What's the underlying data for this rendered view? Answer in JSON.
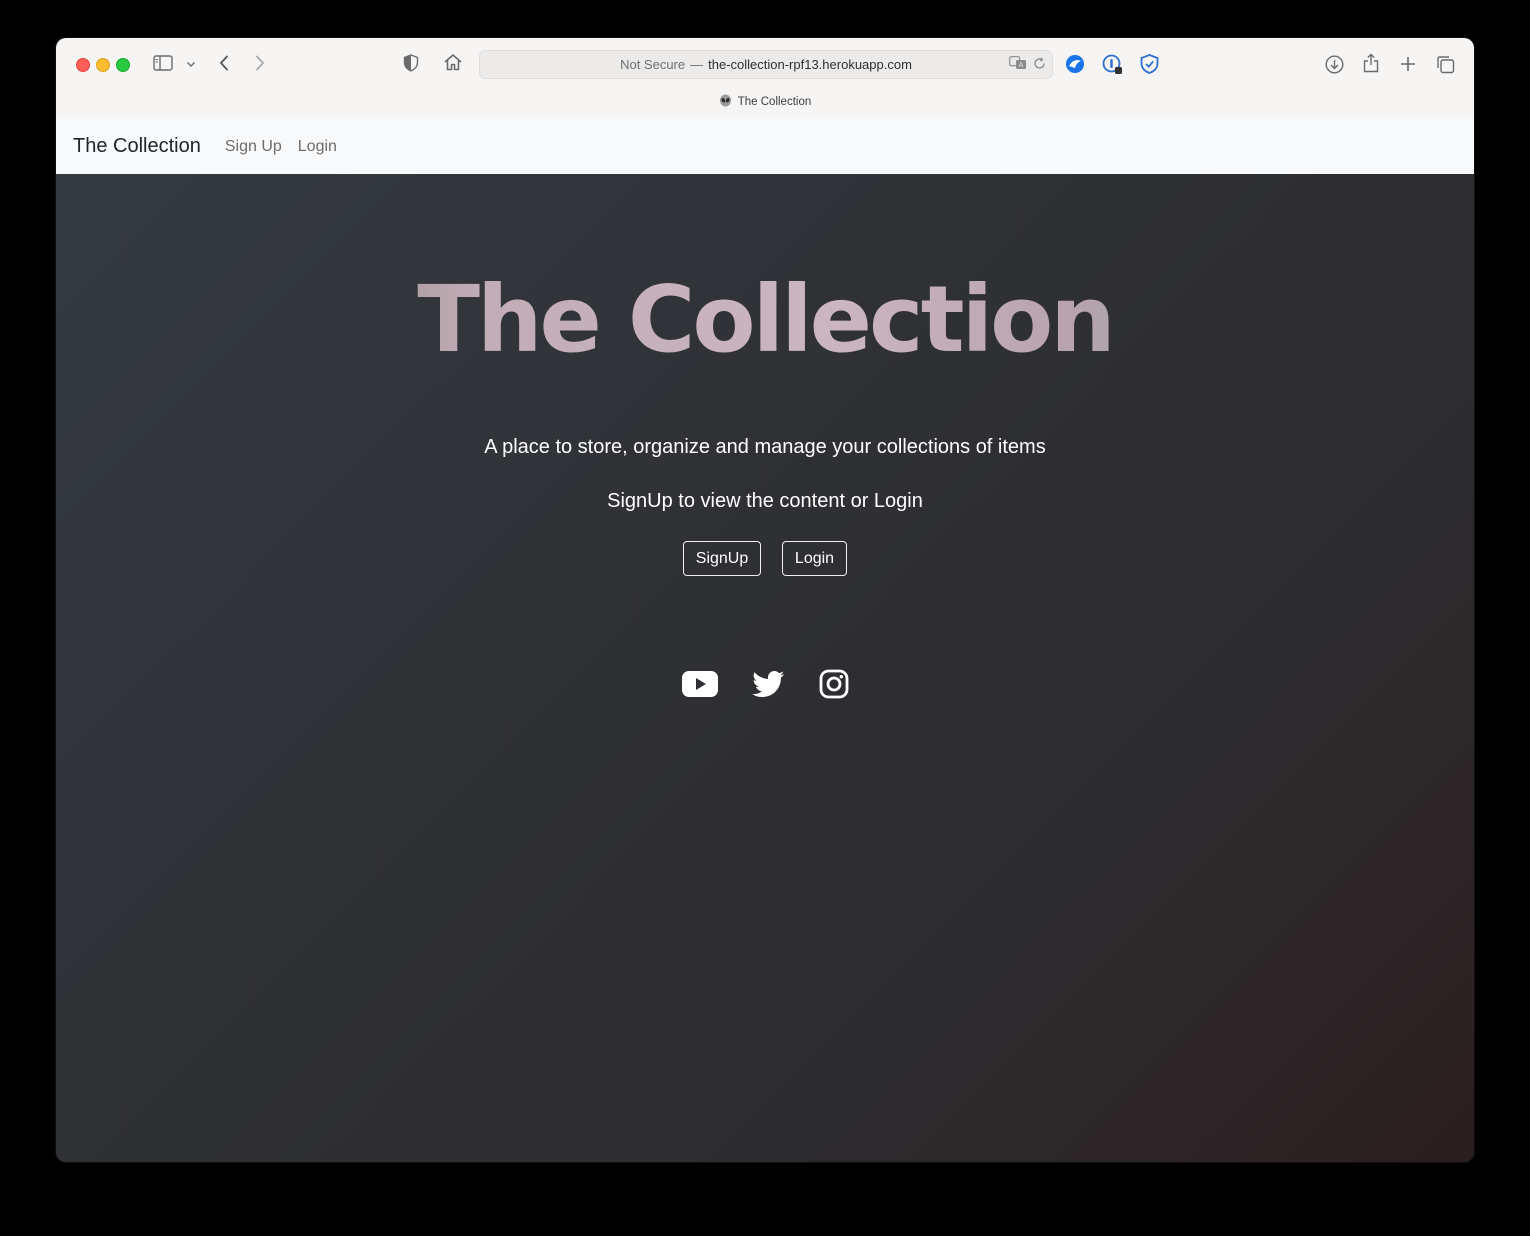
{
  "browser": {
    "url_security": "Not Secure",
    "url_separator": "—",
    "url_host": "the-collection-rpf13.herokuapp.com",
    "tab_title": "The Collection",
    "toolbar_icons": [
      "sidebar-icon",
      "chevron-down-icon",
      "back-icon",
      "forward-icon",
      "shield-icon",
      "home-icon",
      "translate-icon",
      "reload-icon",
      "extension-blue-icon",
      "password-icon",
      "shield-check-icon",
      "download-icon",
      "share-icon",
      "new-tab-icon",
      "tabs-overview-icon"
    ]
  },
  "nav": {
    "brand": "The Collection",
    "links": [
      "Sign Up",
      "Login"
    ]
  },
  "hero": {
    "title": "The Collection",
    "tagline": "A place to store, organize and manage your collections of items",
    "subline": "SignUp to view the content or Login",
    "buttons": [
      "SignUp",
      "Login"
    ],
    "social": [
      "youtube-icon",
      "twitter-icon",
      "instagram-icon"
    ]
  },
  "colors": {
    "nav_bg": "#f8f9fa",
    "hero_bg": "#343a40",
    "text_light": "#ffffff"
  }
}
